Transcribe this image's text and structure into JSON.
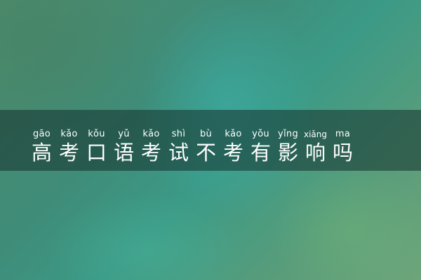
{
  "title": {
    "chars": [
      {
        "pinyin": "gāo",
        "hanzi": "高"
      },
      {
        "pinyin": "kǎo",
        "hanzi": "考"
      },
      {
        "pinyin": "kǒu",
        "hanzi": "口"
      },
      {
        "pinyin": "yǔ",
        "hanzi": "语"
      },
      {
        "pinyin": "kǎo",
        "hanzi": "考"
      },
      {
        "pinyin": "shì",
        "hanzi": "试"
      },
      {
        "pinyin": "bù",
        "hanzi": "不"
      },
      {
        "pinyin": "kǎo",
        "hanzi": "考"
      },
      {
        "pinyin": "yǒu",
        "hanzi": "有"
      },
      {
        "pinyin": "yǐng",
        "hanzi": "影"
      },
      {
        "pinyin": "xiǎng",
        "hanzi": "响"
      },
      {
        "pinyin": "ma",
        "hanzi": "吗"
      }
    ]
  },
  "colors": {
    "text": "#ffffff",
    "band": "#14322d"
  }
}
